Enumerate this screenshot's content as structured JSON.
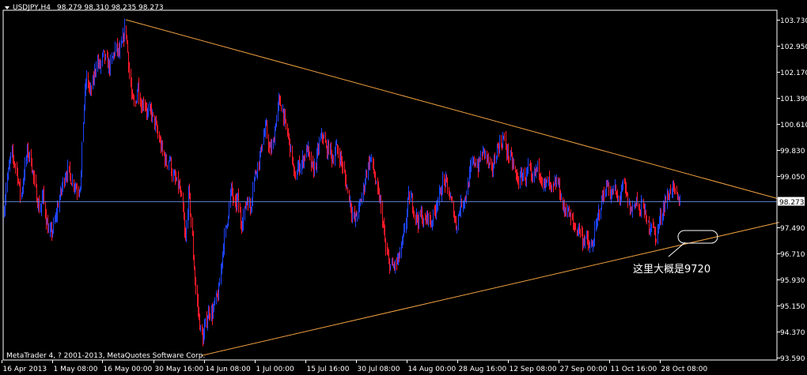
{
  "header": {
    "symbol_timeframe": "USDJPY,H4",
    "ohlc_text": "98.279 98.310 98.235 98.273"
  },
  "copyright": "MetaTrader 4, ? 2001-2013, MetaQuotes Software Corp.",
  "annotation": {
    "text": "这里大概是9720"
  },
  "colors": {
    "background": "#000000",
    "axis": "#ffffff",
    "bull": "#1f44ff",
    "bear": "#ff1a2a",
    "trendline": "#f0a040",
    "price_line": "#5a78c8"
  },
  "chart_data": {
    "type": "candlestick",
    "symbol": "USDJPY",
    "timeframe": "H4",
    "ylim": [
      93.59,
      104.1
    ],
    "y_ticks": [
      "103.730",
      "102.950",
      "102.170",
      "101.390",
      "100.610",
      "99.830",
      "99.050",
      "98.273",
      "97.490",
      "96.710",
      "95.930",
      "95.150",
      "94.370",
      "93.590"
    ],
    "x_ticks": [
      "16 Apr 2013",
      "1 May 08:00",
      "16 May 00:00",
      "30 May 16:00",
      "14 Jun 08:00",
      "1 Jul 00:00",
      "15 Jul 16:00",
      "30 Jul 08:00",
      "14 Aug 00:00",
      "28 Aug 16:00",
      "12 Sep 08:00",
      "27 Sep 00:00",
      "11 Oct 16:00",
      "28 Oct 08:00"
    ],
    "current_price": 98.273,
    "price_path": [
      [
        0,
        98.3
      ],
      [
        3,
        97.6
      ],
      [
        8,
        98.9
      ],
      [
        14,
        99.7
      ],
      [
        20,
        99.3
      ],
      [
        26,
        98.4
      ],
      [
        30,
        99.1
      ],
      [
        34,
        99.8
      ],
      [
        38,
        99.6
      ],
      [
        42,
        99.0
      ],
      [
        46,
        98.4
      ],
      [
        50,
        98.0
      ],
      [
        54,
        98.5
      ],
      [
        58,
        97.7
      ],
      [
        62,
        97.3
      ],
      [
        66,
        97.4
      ],
      [
        70,
        97.8
      ],
      [
        74,
        98.3
      ],
      [
        78,
        98.7
      ],
      [
        82,
        99.1
      ],
      [
        86,
        99.2
      ],
      [
        90,
        98.9
      ],
      [
        94,
        98.8
      ],
      [
        98,
        98.6
      ],
      [
        102,
        98.9
      ],
      [
        105,
        101.0
      ],
      [
        109,
        102.0
      ],
      [
        114,
        101.5
      ],
      [
        118,
        102.0
      ],
      [
        122,
        102.5
      ],
      [
        126,
        102.3
      ],
      [
        130,
        102.7
      ],
      [
        134,
        102.5
      ],
      [
        138,
        102.3
      ],
      [
        142,
        102.6
      ],
      [
        146,
        102.9
      ],
      [
        150,
        102.7
      ],
      [
        154,
        103.0
      ],
      [
        158,
        103.5
      ],
      [
        162,
        102.5
      ],
      [
        166,
        101.4
      ],
      [
        170,
        101.1
      ],
      [
        174,
        101.8
      ],
      [
        178,
        101.1
      ],
      [
        182,
        101.3
      ],
      [
        186,
        100.9
      ],
      [
        190,
        101.0
      ],
      [
        194,
        100.7
      ],
      [
        198,
        100.4
      ],
      [
        202,
        100.0
      ],
      [
        206,
        99.7
      ],
      [
        210,
        99.4
      ],
      [
        214,
        99.6
      ],
      [
        218,
        99.0
      ],
      [
        222,
        98.9
      ],
      [
        226,
        98.7
      ],
      [
        230,
        98.2
      ],
      [
        234,
        97.0
      ],
      [
        238,
        98.6
      ],
      [
        241,
        97.8
      ],
      [
        244,
        96.6
      ],
      [
        248,
        95.4
      ],
      [
        252,
        94.6
      ],
      [
        256,
        94.1
      ],
      [
        260,
        94.7
      ],
      [
        264,
        95.0
      ],
      [
        268,
        94.9
      ],
      [
        272,
        95.3
      ],
      [
        276,
        95.5
      ],
      [
        280,
        96.6
      ],
      [
        284,
        97.3
      ],
      [
        288,
        97.9
      ],
      [
        292,
        98.7
      ],
      [
        296,
        98.1
      ],
      [
        300,
        98.4
      ],
      [
        304,
        97.6
      ],
      [
        308,
        97.9
      ],
      [
        312,
        98.4
      ],
      [
        316,
        98.0
      ],
      [
        320,
        98.9
      ],
      [
        324,
        99.3
      ],
      [
        328,
        99.6
      ],
      [
        332,
        100.2
      ],
      [
        336,
        100.5
      ],
      [
        340,
        99.8
      ],
      [
        344,
        99.9
      ],
      [
        348,
        100.6
      ],
      [
        352,
        101.3
      ],
      [
        356,
        101.1
      ],
      [
        360,
        100.6
      ],
      [
        364,
        100.2
      ],
      [
        368,
        99.7
      ],
      [
        372,
        98.9
      ],
      [
        376,
        99.3
      ],
      [
        380,
        99.4
      ],
      [
        384,
        99.6
      ],
      [
        388,
        99.9
      ],
      [
        392,
        99.4
      ],
      [
        396,
        99.2
      ],
      [
        400,
        99.6
      ],
      [
        404,
        100.1
      ],
      [
        408,
        100.3
      ],
      [
        412,
        99.8
      ],
      [
        416,
        99.9
      ],
      [
        420,
        99.5
      ],
      [
        424,
        99.9
      ],
      [
        428,
        99.7
      ],
      [
        432,
        99.4
      ],
      [
        436,
        98.9
      ],
      [
        440,
        98.5
      ],
      [
        444,
        98.0
      ],
      [
        448,
        97.7
      ],
      [
        452,
        98.0
      ],
      [
        456,
        98.3
      ],
      [
        460,
        98.8
      ],
      [
        464,
        99.3
      ],
      [
        468,
        99.6
      ],
      [
        472,
        99.2
      ],
      [
        476,
        98.6
      ],
      [
        480,
        98.3
      ],
      [
        484,
        97.5
      ],
      [
        488,
        96.7
      ],
      [
        492,
        96.4
      ],
      [
        496,
        96.3
      ],
      [
        500,
        96.4
      ],
      [
        504,
        96.6
      ],
      [
        508,
        97.0
      ],
      [
        512,
        97.6
      ],
      [
        516,
        98.4
      ],
      [
        520,
        98.3
      ],
      [
        524,
        97.9
      ],
      [
        528,
        97.7
      ],
      [
        532,
        97.9
      ],
      [
        536,
        97.6
      ],
      [
        540,
        97.9
      ],
      [
        544,
        97.6
      ],
      [
        548,
        97.9
      ],
      [
        552,
        98.3
      ],
      [
        556,
        98.5
      ],
      [
        560,
        98.9
      ],
      [
        564,
        98.8
      ],
      [
        568,
        98.4
      ],
      [
        572,
        98.1
      ],
      [
        576,
        97.5
      ],
      [
        580,
        98.0
      ],
      [
        584,
        98.3
      ],
      [
        588,
        98.4
      ],
      [
        592,
        98.9
      ],
      [
        596,
        99.4
      ],
      [
        600,
        99.5
      ],
      [
        604,
        99.3
      ],
      [
        608,
        99.7
      ],
      [
        612,
        99.8
      ],
      [
        616,
        99.5
      ],
      [
        620,
        99.2
      ],
      [
        624,
        99.4
      ],
      [
        628,
        99.9
      ],
      [
        632,
        100.0
      ],
      [
        636,
        100.2
      ],
      [
        640,
        99.8
      ],
      [
        644,
        99.6
      ],
      [
        648,
        99.4
      ],
      [
        652,
        99.0
      ],
      [
        656,
        98.9
      ],
      [
        660,
        99.1
      ],
      [
        664,
        99.0
      ],
      [
        668,
        99.3
      ],
      [
        672,
        98.8
      ],
      [
        676,
        99.2
      ],
      [
        680,
        99.3
      ],
      [
        684,
        99.0
      ],
      [
        688,
        98.7
      ],
      [
        692,
        98.9
      ],
      [
        696,
        98.6
      ],
      [
        700,
        98.7
      ],
      [
        704,
        98.9
      ],
      [
        708,
        98.5
      ],
      [
        712,
        98.0
      ],
      [
        716,
        98.1
      ],
      [
        720,
        97.8
      ],
      [
        724,
        97.6
      ],
      [
        728,
        97.4
      ],
      [
        732,
        97.5
      ],
      [
        736,
        97.1
      ],
      [
        740,
        97.2
      ],
      [
        744,
        96.9
      ],
      [
        748,
        96.9
      ],
      [
        752,
        97.4
      ],
      [
        756,
        97.9
      ],
      [
        760,
        98.3
      ],
      [
        764,
        98.6
      ],
      [
        768,
        98.8
      ],
      [
        772,
        98.4
      ],
      [
        776,
        98.7
      ],
      [
        780,
        98.3
      ],
      [
        784,
        98.5
      ],
      [
        788,
        98.8
      ],
      [
        792,
        98.4
      ],
      [
        796,
        98.0
      ],
      [
        800,
        98.1
      ],
      [
        804,
        98.4
      ],
      [
        808,
        97.9
      ],
      [
        812,
        98.3
      ],
      [
        816,
        97.7
      ],
      [
        820,
        97.5
      ],
      [
        824,
        97.7
      ],
      [
        828,
        97.1
      ],
      [
        832,
        97.6
      ],
      [
        836,
        97.9
      ],
      [
        840,
        98.3
      ],
      [
        844,
        98.4
      ],
      [
        848,
        98.7
      ],
      [
        852,
        98.6
      ],
      [
        856,
        98.3
      ],
      [
        860,
        98.3
      ]
    ],
    "trendlines": [
      {
        "from": [
          159,
          103.73
        ],
        "to": [
          985,
          98.35
        ],
        "name": "upper"
      },
      {
        "from": [
          254,
          93.65
        ],
        "to": [
          985,
          97.65
        ],
        "name": "lower"
      }
    ]
  }
}
